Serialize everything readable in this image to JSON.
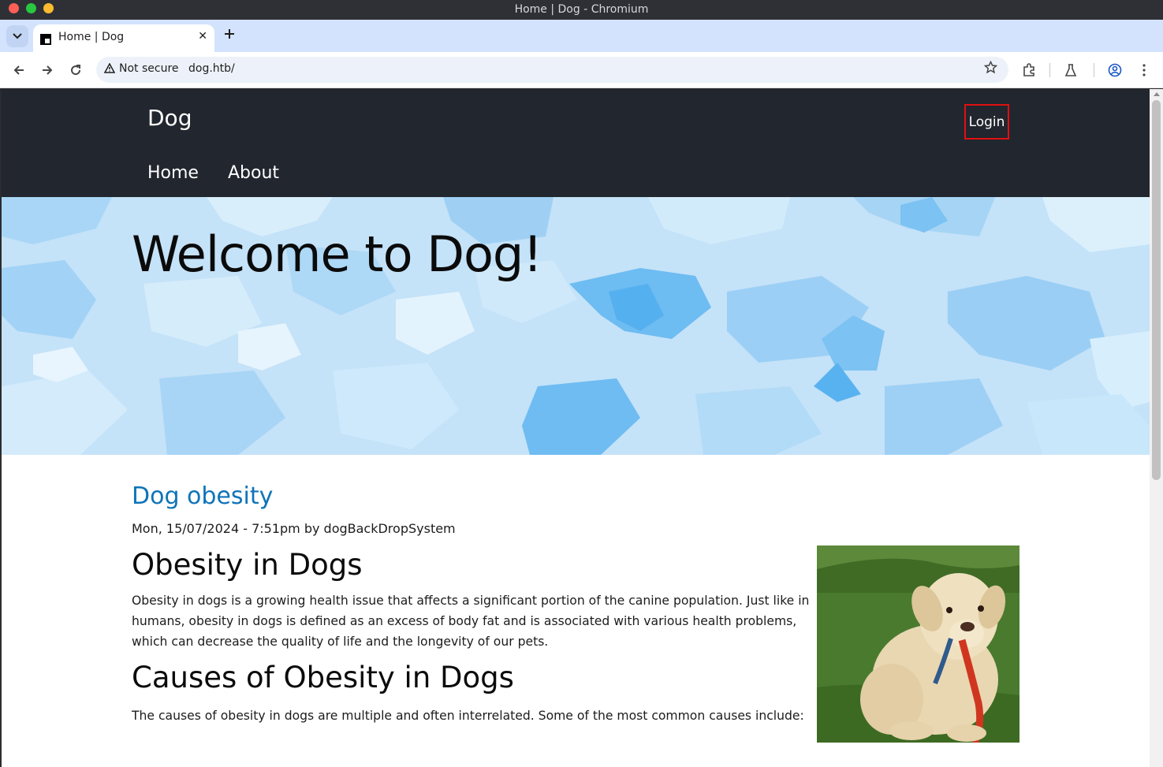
{
  "window": {
    "title": "Home | Dog - Chromium"
  },
  "tabs": [
    {
      "title": "Home | Dog"
    }
  ],
  "toolbar": {
    "security_label": "Not secure",
    "url": "dog.htb/"
  },
  "site": {
    "name": "Dog",
    "login_label": "Login",
    "nav": [
      {
        "label": "Home"
      },
      {
        "label": "About"
      }
    ]
  },
  "hero": {
    "title": "Welcome to Dog!"
  },
  "post": {
    "title": "Dog obesity",
    "meta": "Mon, 15/07/2024 - 7:51pm by dogBackDropSystem",
    "heading1": "Obesity in Dogs",
    "paragraph1": "Obesity in dogs is a growing health issue that affects a significant portion of the canine population. Just like in humans, obesity in dogs is defined as an excess of body fat and is associated with various health problems, which can decrease the quality of life and the longevity of our pets.",
    "heading2": "Causes of Obesity in Dogs",
    "paragraph2": "The causes of obesity in dogs are multiple and often interrelated. Some of the most common causes include:"
  },
  "colors": {
    "header_bg": "#22262e",
    "link": "#0f74b8",
    "highlight": "#e01010",
    "hero_bg": "#bfe0f8"
  },
  "icons": [
    "tab-list-icon",
    "favicon-icon",
    "close-icon",
    "plus-icon",
    "back-icon",
    "forward-icon",
    "reload-icon",
    "warning-icon",
    "star-icon",
    "extensions-icon",
    "labs-icon",
    "profile-icon",
    "menu-icon"
  ]
}
